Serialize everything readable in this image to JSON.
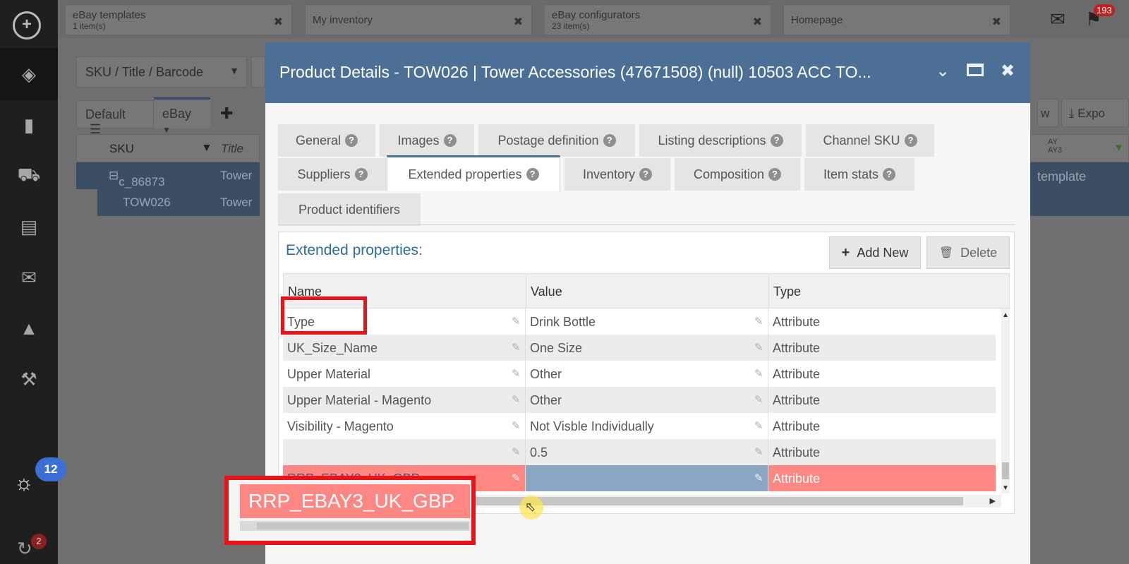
{
  "sidebar": {
    "logo_icon": "app-logo-icon",
    "nav_icons": [
      "cubes-icon",
      "book-icon",
      "truck-icon",
      "chart-icon",
      "envelope-icon",
      "puzzle-icon",
      "wrench-icon"
    ],
    "bulb_badge": "12",
    "sync_badge": "2"
  },
  "top_tabs": [
    {
      "title": "eBay templates",
      "subtitle": "1 item(s)"
    },
    {
      "title": "My inventory",
      "subtitle": ""
    },
    {
      "title": "eBay configurators",
      "subtitle": "23 item(s)"
    },
    {
      "title": "Homepage",
      "subtitle": ""
    }
  ],
  "notifications": {
    "bell_count": "193"
  },
  "inventory": {
    "search_filter": "SKU / Title / Barcode",
    "view_default": "Default",
    "view_ebay": "eBay",
    "col_sku": "SKU",
    "col_title": "Title",
    "rows": [
      {
        "sku": "c_86873",
        "title": "Tower"
      },
      {
        "sku": "TOW026",
        "title": "Tower"
      }
    ],
    "right_button_1": "w",
    "right_button_2": "Expo",
    "right_col": "AY\nAY3",
    "right_cell": "template"
  },
  "modal": {
    "title": "Product Details - TOW026 | Tower Accessories (47671508) (null) 10503 ACC TO...",
    "tabs_row1": [
      "General",
      "Images",
      "Postage definition",
      "Listing descriptions",
      "Channel SKU"
    ],
    "tabs_row2": [
      "Suppliers",
      "Extended properties",
      "Inventory",
      "Composition",
      "Item stats"
    ],
    "tabs_row3": [
      "Product identifiers"
    ],
    "active_tab": "Extended properties",
    "panel_title": "Extended properties:",
    "add_new_label": "Add New",
    "delete_label": "Delete",
    "columns": [
      "Name",
      "Value",
      "Type"
    ],
    "rows": [
      {
        "name": "Type",
        "value": "Drink Bottle",
        "type": "Attribute"
      },
      {
        "name": "UK_Size_Name",
        "value": "One Size",
        "type": "Attribute"
      },
      {
        "name": "Upper Material",
        "value": "Other",
        "type": "Attribute"
      },
      {
        "name": "Upper Material - Magento",
        "value": "Other",
        "type": "Attribute"
      },
      {
        "name": "Visibility - Magento",
        "value": "Not Visble Individually",
        "type": "Attribute"
      },
      {
        "name": "",
        "value": "0.5",
        "type": "Attribute"
      },
      {
        "name": "RRP_EBAY3_UK_GBP",
        "value": "",
        "type": "Attribute"
      }
    ]
  },
  "zoom_label": "RRP_EBAY3_UK_GBP",
  "colors": {
    "modal_header": "#4b6f95",
    "highlight_red": "#ff8783",
    "annotation_red": "#e8141b",
    "selected_value_blue": "#8aa6c4",
    "panel_title_blue": "#2d6da3"
  }
}
